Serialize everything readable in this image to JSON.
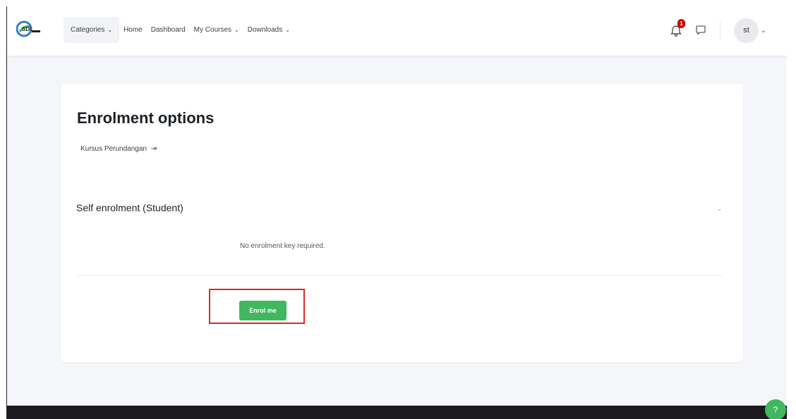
{
  "header": {
    "logo_text": "SDL",
    "nav": [
      {
        "label": "Categories",
        "has_dropdown": true,
        "active": true
      },
      {
        "label": "Home",
        "has_dropdown": false
      },
      {
        "label": "Dashboard",
        "has_dropdown": false
      },
      {
        "label": "My Courses",
        "has_dropdown": true
      },
      {
        "label": "Downloads",
        "has_dropdown": true
      }
    ],
    "notifications_count": "1",
    "user_initials": "st",
    "icons": [
      "bell-icon",
      "chat-icon",
      "chevron-down-icon"
    ]
  },
  "main": {
    "title": "Enrolment options",
    "course_name": "Kursus Perundangan",
    "section_title": "Self enrolment (Student)",
    "note": "No enrolment key required.",
    "enrol_button": "Enrol me"
  },
  "colors": {
    "accent": "#3fb85f",
    "highlight": "#e0262b",
    "badge": "#d40000"
  }
}
